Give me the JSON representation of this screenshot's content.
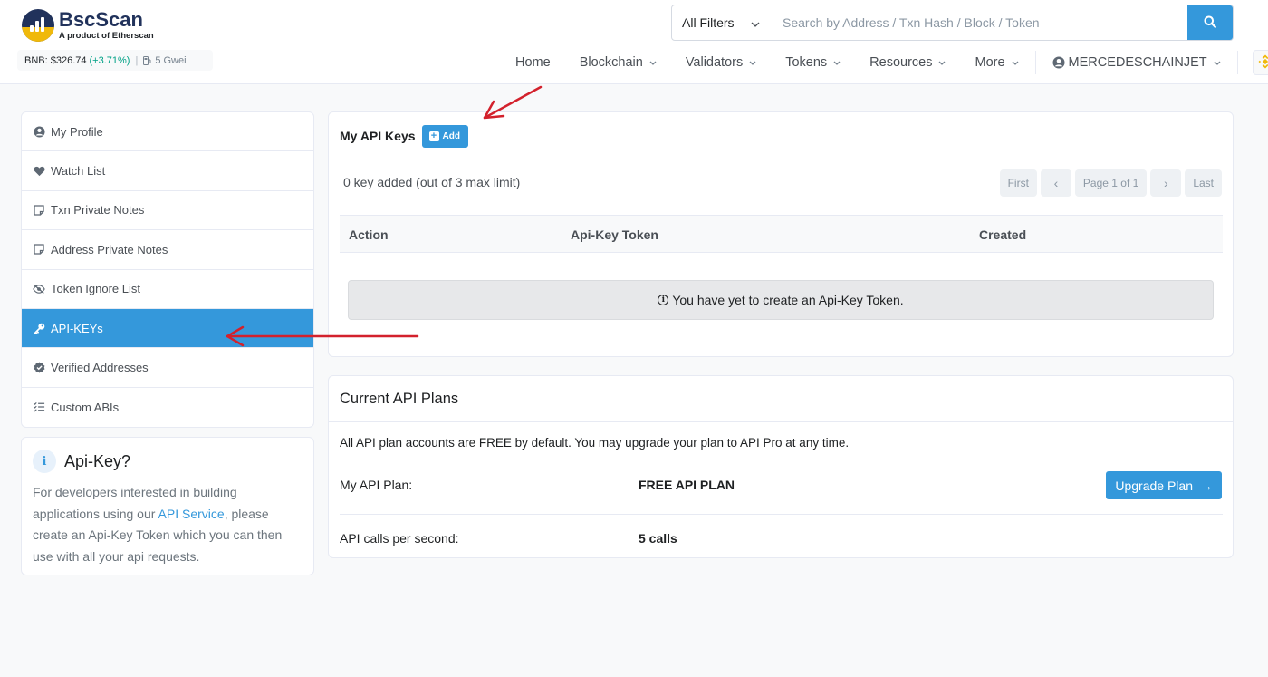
{
  "brand": {
    "name": "BscScan",
    "tagline": "A product of Etherscan",
    "colors": {
      "navy": "#21325b",
      "gold": "#f0b90b",
      "accent": "#3498db"
    }
  },
  "ticker": {
    "price": "BNB: $326.74",
    "change": "(+3.71%)",
    "separator": "|",
    "gas": "5 Gwei",
    "gas_icon": "gas-pump-icon"
  },
  "search": {
    "filter_label": "All Filters",
    "placeholder": "Search by Address / Txn Hash / Block / Token",
    "button_icon": "search-icon"
  },
  "nav": {
    "home": "Home",
    "blockchain": "Blockchain",
    "validators": "Validators",
    "tokens": "Tokens",
    "resources": "Resources",
    "more": "More",
    "user": "MERCEDESCHAINJET",
    "chevron": "⌄"
  },
  "sidebar": {
    "items": [
      {
        "label": "My Profile",
        "icon": "user-circle-icon"
      },
      {
        "label": "Watch List",
        "icon": "heart-icon"
      },
      {
        "label": "Txn Private Notes",
        "icon": "note-icon"
      },
      {
        "label": "Address Private Notes",
        "icon": "note-icon"
      },
      {
        "label": "Token Ignore List",
        "icon": "eye-slash-icon"
      },
      {
        "label": "API-KEYs",
        "icon": "key-icon",
        "active": true
      },
      {
        "label": "Verified Addresses",
        "icon": "badge-check-icon"
      },
      {
        "label": "Custom ABIs",
        "icon": "list-check-icon"
      }
    ]
  },
  "info": {
    "title": "Api-Key?",
    "body_before": "For developers interested in building applications using our ",
    "link": "API Service",
    "body_after": ", please create an Api-Key Token which you can then use with all your api requests."
  },
  "api_keys": {
    "title": "My API Keys",
    "add_label": "Add",
    "count_text": "0 key added (out of 3 max limit)",
    "pager": {
      "first": "First",
      "prev": "‹",
      "page": "Page 1 of 1",
      "next": "›",
      "last": "Last"
    },
    "columns": [
      "Action",
      "Api-Key Token",
      "Created"
    ],
    "empty_message": "You have yet to create an Api-Key Token."
  },
  "plans": {
    "title": "Current API Plans",
    "description": "All API plan accounts are FREE by default. You may upgrade your plan to API Pro at any time.",
    "plan_label": "My API Plan:",
    "plan_value": "FREE API PLAN",
    "calls_label": "API calls per second:",
    "calls_value": "5 calls",
    "upgrade_label": "Upgrade Plan",
    "upgrade_arrow": "→"
  }
}
